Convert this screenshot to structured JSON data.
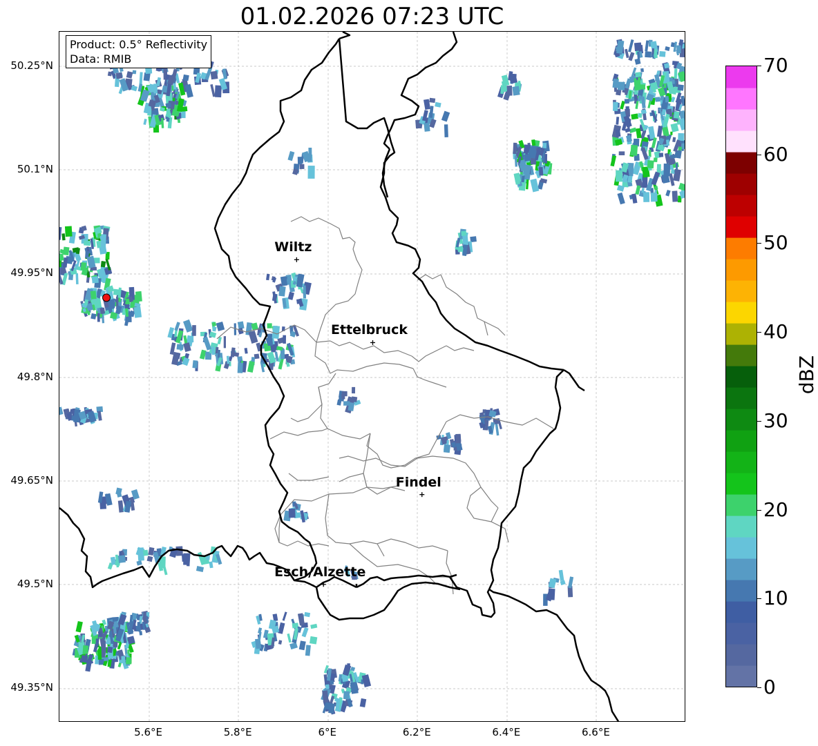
{
  "title": "01.02.2026 07:23 UTC",
  "info_box": {
    "product": "Product: 0.5° Reflectivity",
    "data_source": "Data: RMIB"
  },
  "axes": {
    "lat_ticks": [
      "50.25°N",
      "50.1°N",
      "49.95°N",
      "49.8°N",
      "49.65°N",
      "49.5°N",
      "49.35°N"
    ],
    "lon_ticks": [
      "5.6°E",
      "5.8°E",
      "6°E",
      "6.2°E",
      "6.4°E",
      "6.6°E"
    ],
    "extent": {
      "lon_min": 5.4,
      "lon_max": 6.8,
      "lat_min": 49.3,
      "lat_max": 50.3
    },
    "grid": true
  },
  "cities": [
    {
      "name": "Wiltz",
      "lon": 5.93,
      "lat": 49.97
    },
    {
      "name": "Ettelbruck",
      "lon": 6.1,
      "lat": 49.85
    },
    {
      "name": "Findel",
      "lon": 6.21,
      "lat": 49.63
    },
    {
      "name": "Esch/Alzette",
      "lon": 5.99,
      "lat": 49.5
    }
  ],
  "radar_site": {
    "lon": 5.505,
    "lat": 49.915,
    "color": "#ee1111"
  },
  "colorbar": {
    "unit": "dBZ",
    "min": 0,
    "max": 70,
    "tick_labels": [
      "0",
      "10",
      "20",
      "30",
      "40",
      "50",
      "60",
      "70"
    ],
    "colors": [
      "#6373a6",
      "#5568a0",
      "#4a62a3",
      "#3f5ea3",
      "#4678b0",
      "#579bc5",
      "#66c2da",
      "#5fd6c2",
      "#3dd26c",
      "#14c41b",
      "#13b317",
      "#10a112",
      "#0e8a12",
      "#0b750f",
      "#065f0b",
      "#447a0b",
      "#adb203",
      "#fcd600",
      "#fdb304",
      "#fd9a00",
      "#fd7c00",
      "#df0000",
      "#bd0000",
      "#9e0000",
      "#7d0000",
      "#ffe1fd",
      "#feb3fd",
      "#ff76ff",
      "#ec3aee"
    ]
  }
}
